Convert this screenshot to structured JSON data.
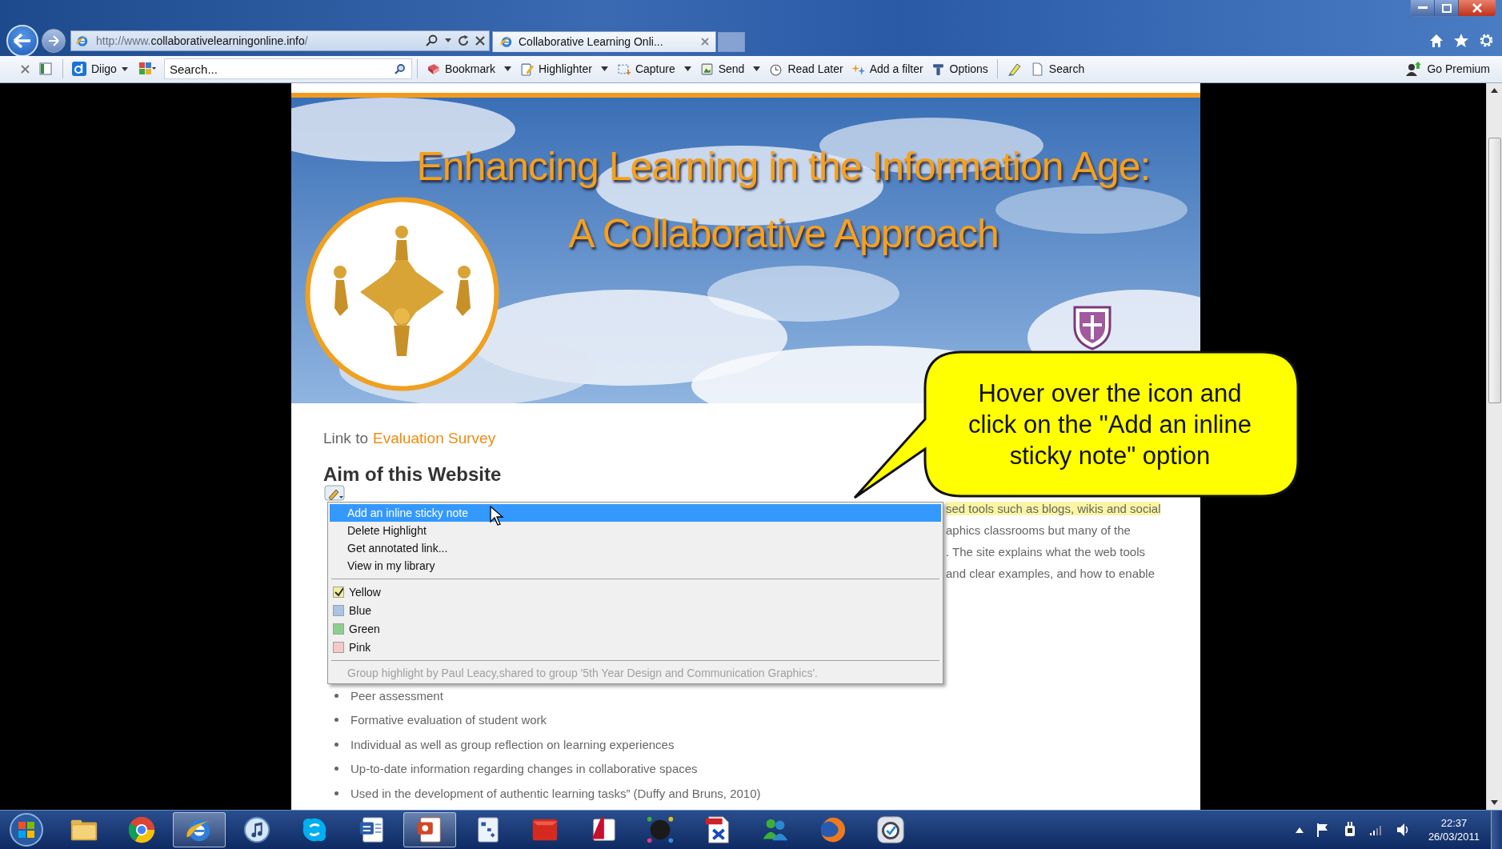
{
  "browser": {
    "url": "http://www.**collaborativelearningonline.info**/",
    "tab_title": "Collaborative Learning Onli..."
  },
  "toolbar": {
    "diigo_label": "Diigo",
    "search_placeholder": "Search...",
    "items": [
      {
        "kind": "bookmark",
        "label": "Bookmark",
        "menu": true
      },
      {
        "kind": "highlighter",
        "label": "Highlighter",
        "menu": true
      },
      {
        "kind": "capture",
        "label": "Capture",
        "menu": true
      },
      {
        "kind": "send",
        "label": "Send",
        "menu": true
      },
      {
        "kind": "read-later",
        "label": "Read Later",
        "menu": false
      },
      {
        "kind": "filter",
        "label": "Add a filter",
        "menu": false
      },
      {
        "kind": "options",
        "label": "Options",
        "menu": false
      }
    ],
    "extra_items": [
      {
        "kind": "page",
        "label": "Search"
      }
    ],
    "premium_label": "Go Premium"
  },
  "page": {
    "banner_title": "Enhancing Learning in the Information Age:\nA Collaborative Approach",
    "link_prefix": "Link to",
    "link_label": "Evaluation Survey",
    "heading": "Aim of this Website",
    "paragraph_lines": [
      {
        "text": "sed tools such as blogs, wikis and social",
        "highlighted": true
      },
      {
        "text": "aphics classrooms but many of the",
        "highlighted": false
      },
      {
        "text": ". The site explains what the web tools",
        "highlighted": false
      },
      {
        "text": "and clear examples, and how to enable",
        "highlighted": false
      }
    ],
    "bullets": [
      "Peer assessment",
      "Formative evaluation of student work",
      "Individual as well as group reflection on learning experiences",
      "Up-to-date information regarding changes in collaborative spaces",
      "Used in the development of authentic learning tasks” (Duffy and Bruns, 2010)"
    ]
  },
  "context_menu": {
    "actions": [
      {
        "label": "Add an inline sticky note",
        "selected": true
      },
      {
        "label": "Delete Highlight",
        "selected": false
      },
      {
        "label": "Get annotated link...",
        "selected": false
      },
      {
        "label": "View in my library",
        "selected": false
      }
    ],
    "colors": [
      {
        "label": "Yellow",
        "checked": true,
        "color": "#f3ee9c"
      },
      {
        "label": "Blue",
        "checked": false,
        "color": "#a8c4e6"
      },
      {
        "label": "Green",
        "checked": false,
        "color": "#8ccf8c"
      },
      {
        "label": "Pink",
        "checked": false,
        "color": "#f6c8c8"
      }
    ],
    "note": "Group highlight by Paul Leacy,shared to group '5th Year Design and Communication Graphics'."
  },
  "callout": {
    "text": "Hover over the icon and click on the \"Add an inline sticky note\" option"
  },
  "taskbar": {
    "apps": [
      {
        "kind": "folder",
        "active": false
      },
      {
        "kind": "chrome",
        "active": false
      },
      {
        "kind": "ie",
        "active": true
      },
      {
        "kind": "itunes",
        "active": false
      },
      {
        "kind": "skype",
        "active": false
      },
      {
        "kind": "word",
        "active": false
      },
      {
        "kind": "powerpoint",
        "active": true
      },
      {
        "kind": "project",
        "active": false
      },
      {
        "kind": "solidworks",
        "active": false
      },
      {
        "kind": "autocad",
        "active": false
      },
      {
        "kind": "hp",
        "active": false
      },
      {
        "kind": "pdf",
        "active": false
      },
      {
        "kind": "messenger",
        "active": false
      },
      {
        "kind": "firefox",
        "active": false
      },
      {
        "kind": "clock",
        "active": false
      }
    ],
    "time": "22:37",
    "date": "26/03/2011"
  }
}
